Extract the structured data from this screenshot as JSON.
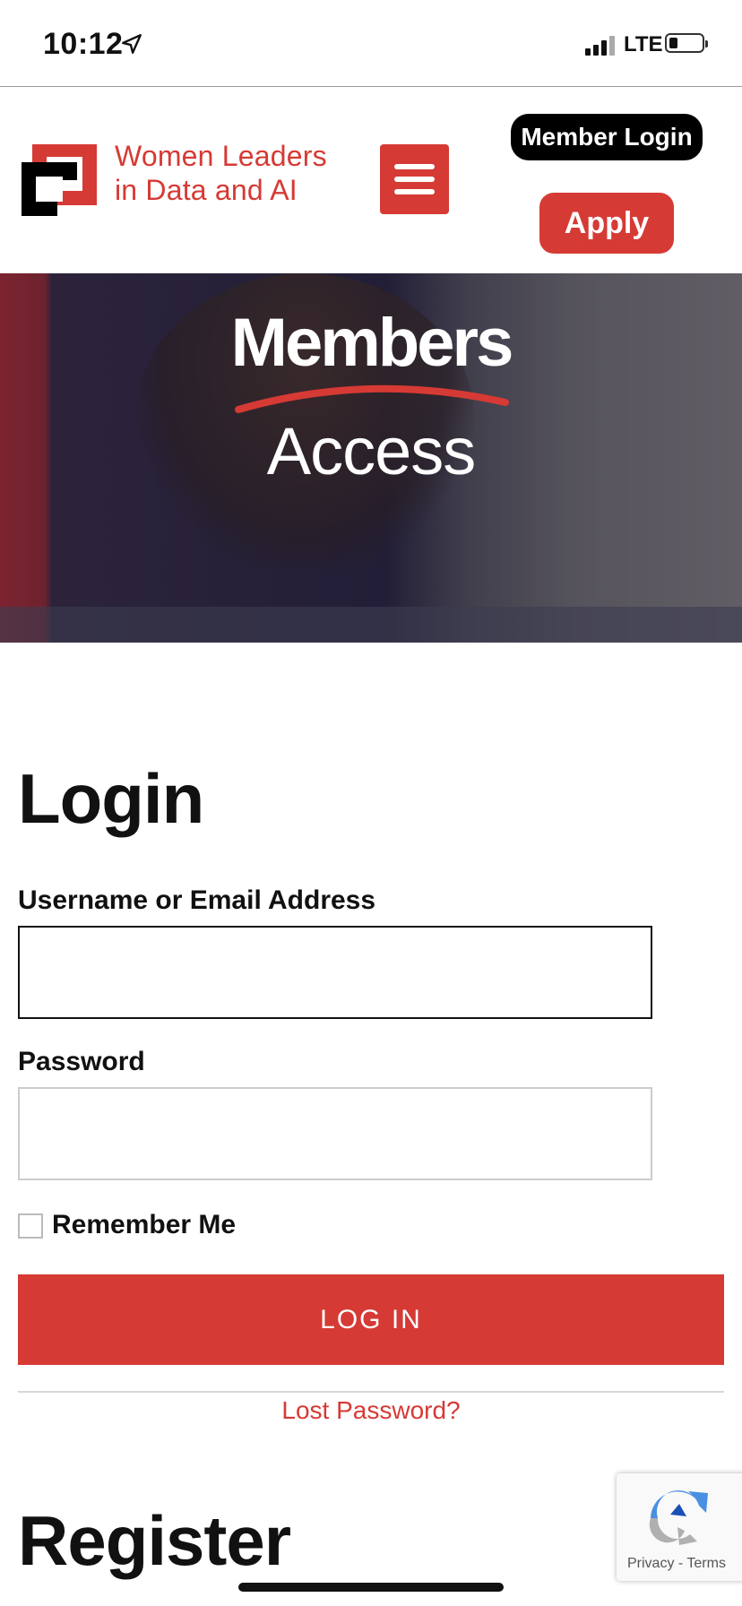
{
  "status_bar": {
    "time": "10:12",
    "network": "LTE",
    "icons": [
      "location-arrow-icon",
      "signal-bars-icon",
      "battery-icon"
    ]
  },
  "header": {
    "logo_text_line1": "Women Leaders",
    "logo_text_line2": "in Data and AI",
    "menu_icon": "hamburger-menu-icon",
    "member_login_label": "Member Login",
    "apply_label": "Apply",
    "accent_color": "#d63a34"
  },
  "hero": {
    "line1": "Members",
    "line2": "Access"
  },
  "login": {
    "title": "Login",
    "username_label": "Username or Email Address",
    "username_value": "",
    "password_label": "Password",
    "password_value": "",
    "remember_label": "Remember Me",
    "remember_checked": false,
    "submit_label": "LOG IN",
    "lost_password_label": "Lost Password?"
  },
  "register": {
    "title": "Register"
  },
  "recaptcha": {
    "privacy_label": "Privacy",
    "separator": "-",
    "terms_label": "Terms"
  }
}
